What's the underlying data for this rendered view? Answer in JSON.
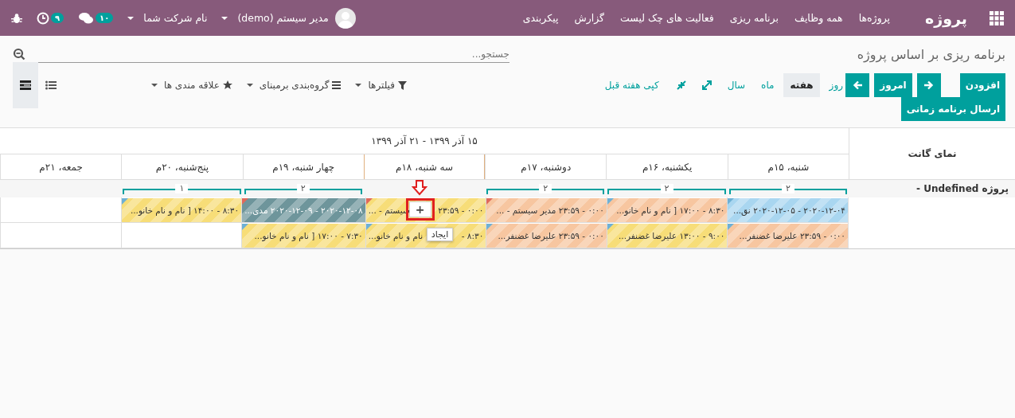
{
  "navbar": {
    "app_name": "پروژه",
    "menu": [
      "پروژه‌ها",
      "همه وظایف",
      "برنامه ریزی",
      "فعالیت های چک لیست",
      "گزارش",
      "پیکربندی"
    ],
    "activity_count": "۹",
    "message_count": "۱۰",
    "company": "نام شرکت شما",
    "user": "مدیر سیستم (demo)"
  },
  "breadcrumb": "برنامه ریزی بر اساس پروژه",
  "search": {
    "placeholder": "جستجو..."
  },
  "buttons": {
    "add": "افزودن",
    "send": "ارسال برنامه زمانی",
    "today": "امروز"
  },
  "scales": [
    {
      "label": "روز",
      "selected": false
    },
    {
      "label": "هفته",
      "selected": true
    },
    {
      "label": "ماه",
      "selected": false
    },
    {
      "label": "سال",
      "selected": false
    }
  ],
  "copy_button": "کپی هفته قبل",
  "search_options": [
    {
      "label": "فیلترها",
      "kind": "filter"
    },
    {
      "label": "گروه‌بندی برمبنای",
      "kind": "group"
    },
    {
      "label": "علاقه مندی ها",
      "kind": "favorite"
    }
  ],
  "views": [
    {
      "kind": "gantt",
      "selected": true
    },
    {
      "kind": "list",
      "selected": false
    }
  ],
  "gantt": {
    "title": "نمای گانت",
    "range": "۱۵ آذر ۱۳۹۹ - ۲۱ آذر ۱۳۹۹",
    "group": "پروژه Undefined -",
    "days": [
      {
        "label": "شنبه، ۱۵م",
        "count": "۲",
        "today": false
      },
      {
        "label": "یکشنبه، ۱۶م",
        "count": "۲",
        "today": false
      },
      {
        "label": "دوشنبه، ۱۷م",
        "count": "۲",
        "today": false
      },
      {
        "label": "سه شنبه، ۱۸م",
        "today": true
      },
      {
        "label": "چهار شنبه، ۱۹م",
        "count": "۲",
        "today": false
      },
      {
        "label": "پنج‌شنبه، ۲۰م",
        "count": "۱",
        "today": false
      },
      {
        "label": "جمعه، ۲۱م",
        "today": false
      }
    ],
    "rows": [
      [
        {
          "kind": "pill",
          "text": "۲۰۲۰-۱۲-۰۴ - ۲۰۲۰-۱۲-۰۵ نق...",
          "color": "#a9d6f0",
          "warning": false,
          "hovered": false
        },
        {
          "kind": "pill",
          "text": "۸:۳۰ - ۱۷:۰۰ [ نام و نام خانو...",
          "color": "#f7c6a0",
          "warning": false,
          "hovered": false
        },
        {
          "kind": "pill",
          "text": "۰:۰۰ - ۲۳:۵۹ مدیر سیستم - ...",
          "color": "#f7c6a0",
          "warning": true,
          "hovered": false
        },
        {
          "kind": "pill",
          "text": "۰:۰۰ - ۲۳:۵۹",
          "text_after": "سیستم - ...",
          "color": "#f7dd78",
          "warning": true,
          "hovered": true,
          "create_label": "+",
          "tooltip": "ایجاد"
        },
        {
          "kind": "pill",
          "text": "۲۰۲۰-۱۲-۰۸ - ۲۰۲۰-۱۲-۰۹ مدی...",
          "color": "#6e959b",
          "warning": true,
          "hovered": false
        },
        {
          "kind": "pill",
          "text": "۸:۳۰ - ۱۴:۰۰ [ نام و نام خانو...",
          "color": "#f7dd78",
          "warning": false,
          "hovered": false
        },
        {
          "kind": "empty"
        }
      ],
      [
        {
          "kind": "pill",
          "text": "۰:۰۰ - ۲۳:۵۹ علیرضا غضنفر...",
          "color": "#f7c6a0",
          "warning": false,
          "hovered": false
        },
        {
          "kind": "pill",
          "text": "۹:۰۰ - ۱۳:۰۰ علیرضا غضنفر...",
          "color": "#f7dd78",
          "warning": false,
          "hovered": false
        },
        {
          "kind": "pill",
          "text": "۰:۰۰ - ۲۳:۵۹ علیرضا غضنفر...",
          "color": "#f7c6a0",
          "warning": false,
          "hovered": false
        },
        {
          "kind": "pill",
          "text": "۸:۳۰ -",
          "text_after": "نام و نام خانو...",
          "color": "#f7dd78",
          "warning": false,
          "hovered": false
        },
        {
          "kind": "pill",
          "text": "۷:۳۰ - ۱۷:۰۰ [ نام و نام خانو...",
          "color": "#f7dd78",
          "warning": false,
          "hovered": false
        },
        {
          "kind": "empty"
        },
        {
          "kind": "empty"
        }
      ]
    ]
  }
}
